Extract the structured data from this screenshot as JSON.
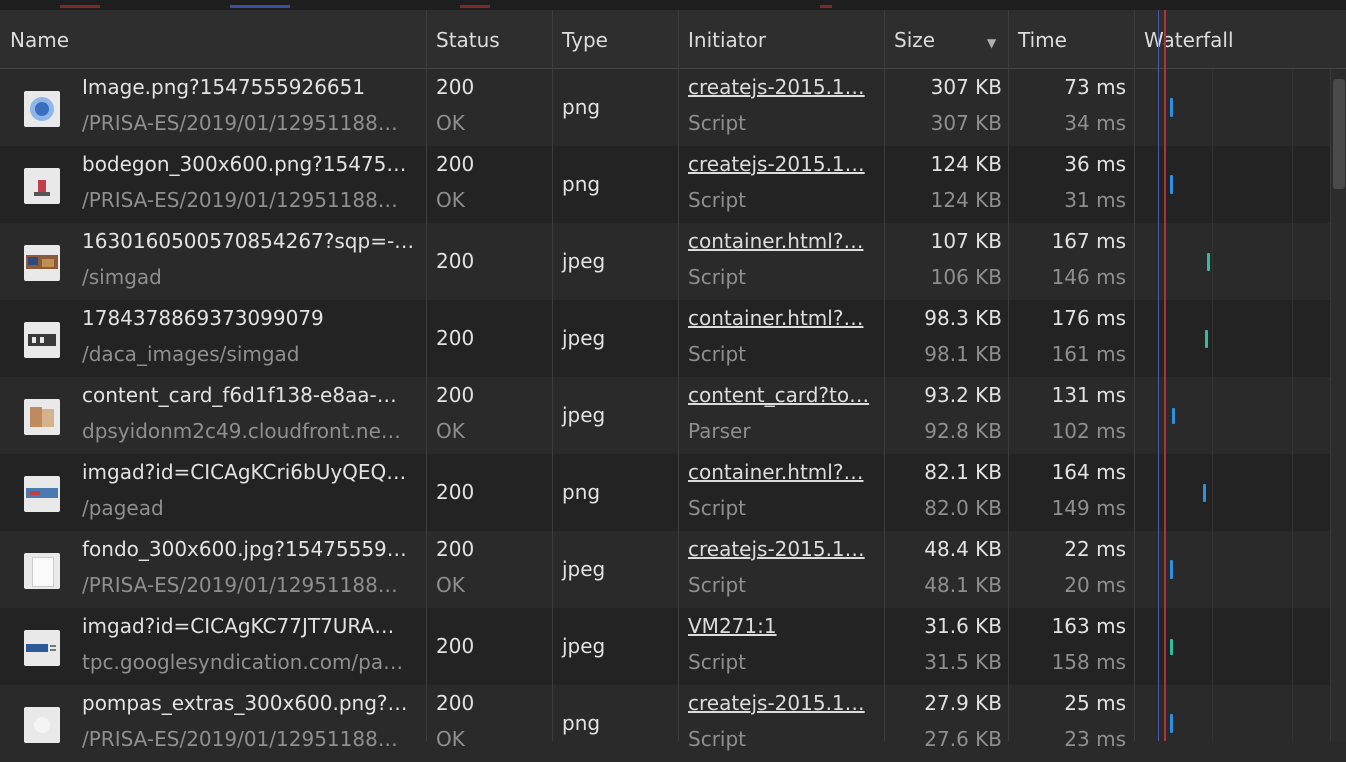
{
  "columns": {
    "name": "Name",
    "status": "Status",
    "type": "Type",
    "initiator": "Initiator",
    "size": "Size",
    "time": "Time",
    "waterfall": "Waterfall"
  },
  "sort_arrow": "▼",
  "rows": [
    {
      "name": "Image.png?1547555926651",
      "path": "/PRISA-ES/2019/01/12951188…",
      "status": "200",
      "status_text": "OK",
      "type": "png",
      "initiator": "createjs-2015.1…",
      "initiator_type": "Script",
      "size": "307 KB",
      "resource_size": "307 KB",
      "time": "73 ms",
      "latency": "34 ms",
      "icon": "image-5d-thumbnail",
      "wf_color": "#2f8fe0",
      "wf_pos": 0.16,
      "wf_len": 0.12
    },
    {
      "name": "bodegon_300x600.png?15475…",
      "path": "/PRISA-ES/2019/01/12951188…",
      "status": "200",
      "status_text": "OK",
      "type": "png",
      "initiator": "createjs-2015.1…",
      "initiator_type": "Script",
      "size": "124 KB",
      "resource_size": "124 KB",
      "time": "36 ms",
      "latency": "31 ms",
      "icon": "image-bodegon-thumbnail",
      "wf_color": "#2f8fe0",
      "wf_pos": 0.16,
      "wf_len": 0.12
    },
    {
      "name": "1630160500570854267?sqp=-…",
      "path": "/simgad",
      "status": "200",
      "status_text": "",
      "type": "jpeg",
      "initiator": "container.html?…",
      "initiator_type": "Script",
      "size": "107 KB",
      "resource_size": "106 KB",
      "time": "167 ms",
      "latency": "146 ms",
      "icon": "image-photo-thumbnail",
      "wf_color": "#2fbf9f",
      "wf_pos": 0.36,
      "wf_len": 0.11
    },
    {
      "name": "1784378869373099079",
      "path": "/daca_images/simgad",
      "status": "200",
      "status_text": "",
      "type": "jpeg",
      "initiator": "container.html?…",
      "initiator_type": "Script",
      "size": "98.3 KB",
      "resource_size": "98.1 KB",
      "time": "176 ms",
      "latency": "161 ms",
      "icon": "image-logo-thumbnail",
      "wf_color": "#2fbf9f",
      "wf_pos": 0.35,
      "wf_len": 0.11
    },
    {
      "name": "content_card_f6d1f138-e8aa-…",
      "path": "dpsyidonm2c49.cloudfront.ne…",
      "status": "200",
      "status_text": "OK",
      "type": "jpeg",
      "initiator": "content_card?to…",
      "initiator_type": "Parser",
      "size": "93.2 KB",
      "resource_size": "92.8 KB",
      "time": "131 ms",
      "latency": "102 ms",
      "icon": "image-card-thumbnail",
      "wf_color": "#2f8fe0",
      "wf_pos": 0.17,
      "wf_len": 0.1
    },
    {
      "name": "imgad?id=CICAgKCri6bUyQEQ…",
      "path": "/pagead",
      "status": "200",
      "status_text": "",
      "type": "png",
      "initiator": "container.html?…",
      "initiator_type": "Script",
      "size": "82.1 KB",
      "resource_size": "82.0 KB",
      "time": "164 ms",
      "latency": "149 ms",
      "icon": "image-banner-thumbnail",
      "wf_color": "#2f8fe0",
      "wf_pos": 0.34,
      "wf_len": 0.11
    },
    {
      "name": "fondo_300x600.jpg?15475559…",
      "path": "/PRISA-ES/2019/01/12951188…",
      "status": "200",
      "status_text": "OK",
      "type": "jpeg",
      "initiator": "createjs-2015.1…",
      "initiator_type": "Script",
      "size": "48.4 KB",
      "resource_size": "48.1 KB",
      "time": "22 ms",
      "latency": "20 ms",
      "icon": "image-blank-thumbnail",
      "wf_color": "#2f8fe0",
      "wf_pos": 0.16,
      "wf_len": 0.12
    },
    {
      "name": "imgad?id=CICAgKC77JT7URA…",
      "path": "tpc.googlesyndication.com/pa…",
      "status": "200",
      "status_text": "",
      "type": "jpeg",
      "initiator": "VM271:1",
      "initiator_type": "Script",
      "size": "31.6 KB",
      "resource_size": "31.5 KB",
      "time": "163 ms",
      "latency": "158 ms",
      "icon": "image-ad-thumbnail",
      "wf_color": "#2fbf9f",
      "wf_pos": 0.16,
      "wf_len": 0.1
    },
    {
      "name": "pompas_extras_300x600.png?…",
      "path": "/PRISA-ES/2019/01/12951188…",
      "status": "200",
      "status_text": "OK",
      "type": "png",
      "initiator": "createjs-2015.1…",
      "initiator_type": "Script",
      "size": "27.9 KB",
      "resource_size": "27.6 KB",
      "time": "25 ms",
      "latency": "23 ms",
      "icon": "image-pompas-thumbnail",
      "wf_color": "#2f8fe0",
      "wf_pos": 0.16,
      "wf_len": 0.12
    }
  ]
}
